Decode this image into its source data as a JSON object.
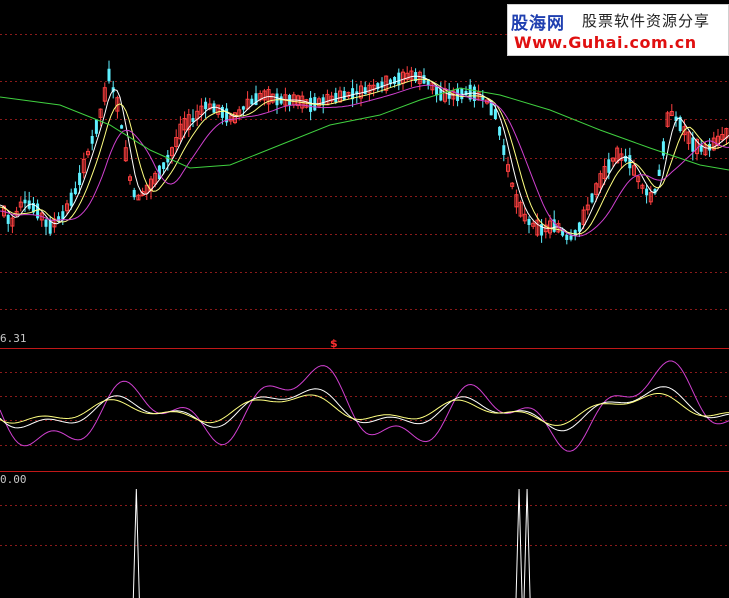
{
  "watermark": {
    "brand": "股海网",
    "tagline": "股票软件资源分享",
    "url": "Www.Guhai.com.cn"
  },
  "colors": {
    "background": "#000000",
    "grid": "#8b1a1a",
    "separator": "#c01818",
    "candle_up": "#ff4040",
    "candle_down": "#5ff0ff",
    "ma_fast": "#ffffff",
    "ma_mid": "#ffff80",
    "ma_slow": "#d040d0",
    "ma_long": "#40d040",
    "osc_line": "#d040d0",
    "signal": "#ffffff",
    "marker": "#ff3030"
  },
  "chart_data": [
    {
      "type": "candlestick",
      "panel": "price",
      "grid": true,
      "note": "Daily candlesticks with white, yellow, magenta and green moving averages; axis values not printed"
    },
    {
      "type": "line",
      "panel": "oscillator",
      "top_label": "6.31",
      "marker": "$",
      "series_colors": [
        "#d040d0",
        "#ffffff",
        "#ffff80"
      ]
    },
    {
      "type": "bar",
      "panel": "signal",
      "top_label": "0.00",
      "spikes_at_fraction": [
        0.187,
        0.712,
        0.723
      ]
    }
  ]
}
